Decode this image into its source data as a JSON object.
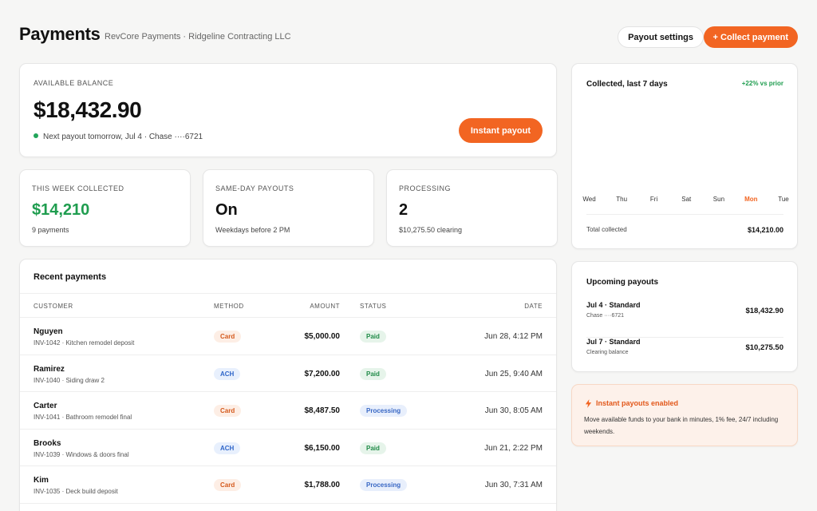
{
  "header": {
    "title": "Payments",
    "subtitle": "RevCore Payments · Ridgeline Contracting LLC",
    "payout_settings_label": "Payout settings",
    "collect_payment_label": "+ Collect payment"
  },
  "balance": {
    "label": "AVAILABLE BALANCE",
    "amount": "$18,432.90",
    "next_payout": "Next payout tomorrow, Jul 4 · Chase ····6721",
    "instant_payout_label": "Instant payout"
  },
  "stats": {
    "week": {
      "label": "THIS WEEK COLLECTED",
      "value": "$14,210",
      "sub": "9 payments"
    },
    "sameday": {
      "label": "SAME-DAY PAYOUTS",
      "value": "On",
      "sub": "Weekdays before 2 PM"
    },
    "processing": {
      "label": "PROCESSING",
      "value": "2",
      "sub": "$10,275.50 clearing"
    }
  },
  "recent": {
    "title": "Recent payments",
    "columns": {
      "customer": "CUSTOMER",
      "method": "METHOD",
      "amount": "AMOUNT",
      "status": "STATUS",
      "date": "DATE"
    },
    "rows": [
      {
        "name": "Nguyen",
        "desc": "INV-1042 · Kitchen remodel deposit",
        "method": "Card",
        "amount": "$5,000.00",
        "status": "Paid",
        "date": "Jun 28, 4:12 PM"
      },
      {
        "name": "Ramirez",
        "desc": "INV-1040 · Siding draw 2",
        "method": "ACH",
        "amount": "$7,200.00",
        "status": "Paid",
        "date": "Jun 25, 9:40 AM"
      },
      {
        "name": "Carter",
        "desc": "INV-1041 · Bathroom remodel final",
        "method": "Card",
        "amount": "$8,487.50",
        "status": "Processing",
        "date": "Jun 30, 8:05 AM"
      },
      {
        "name": "Brooks",
        "desc": "INV-1039 · Windows & doors final",
        "method": "ACH",
        "amount": "$6,150.00",
        "status": "Paid",
        "date": "Jun 21, 2:22 PM"
      },
      {
        "name": "Kim",
        "desc": "INV-1035 · Deck build deposit",
        "method": "Card",
        "amount": "$1,788.00",
        "status": "Processing",
        "date": "Jun 30, 7:31 AM"
      }
    ]
  },
  "collected": {
    "title": "Collected, last 7 days",
    "delta": "+22% vs prior",
    "days": [
      "Wed",
      "Thu",
      "Fri",
      "Sat",
      "Sun",
      "Mon",
      "Tue"
    ],
    "active_day": "Mon",
    "total_label": "Total collected",
    "total_value": "$14,210.00"
  },
  "upcoming": {
    "title": "Upcoming payouts",
    "items": [
      {
        "heading": "Jul 4 · Standard",
        "sub": "Chase ····6721",
        "value": "$18,432.90"
      },
      {
        "heading": "Jul 7 · Standard",
        "sub": "Clearing balance",
        "value": "$10,275.50"
      }
    ]
  },
  "notice": {
    "icon": "bolt-icon",
    "title": "Instant payouts enabled",
    "body": "Move available funds to your bank in minutes, 1% fee, 24/7 including weekends."
  },
  "colors": {
    "accent": "#f26522",
    "positive": "#1f9d4f",
    "ach": "#2f66c9"
  }
}
